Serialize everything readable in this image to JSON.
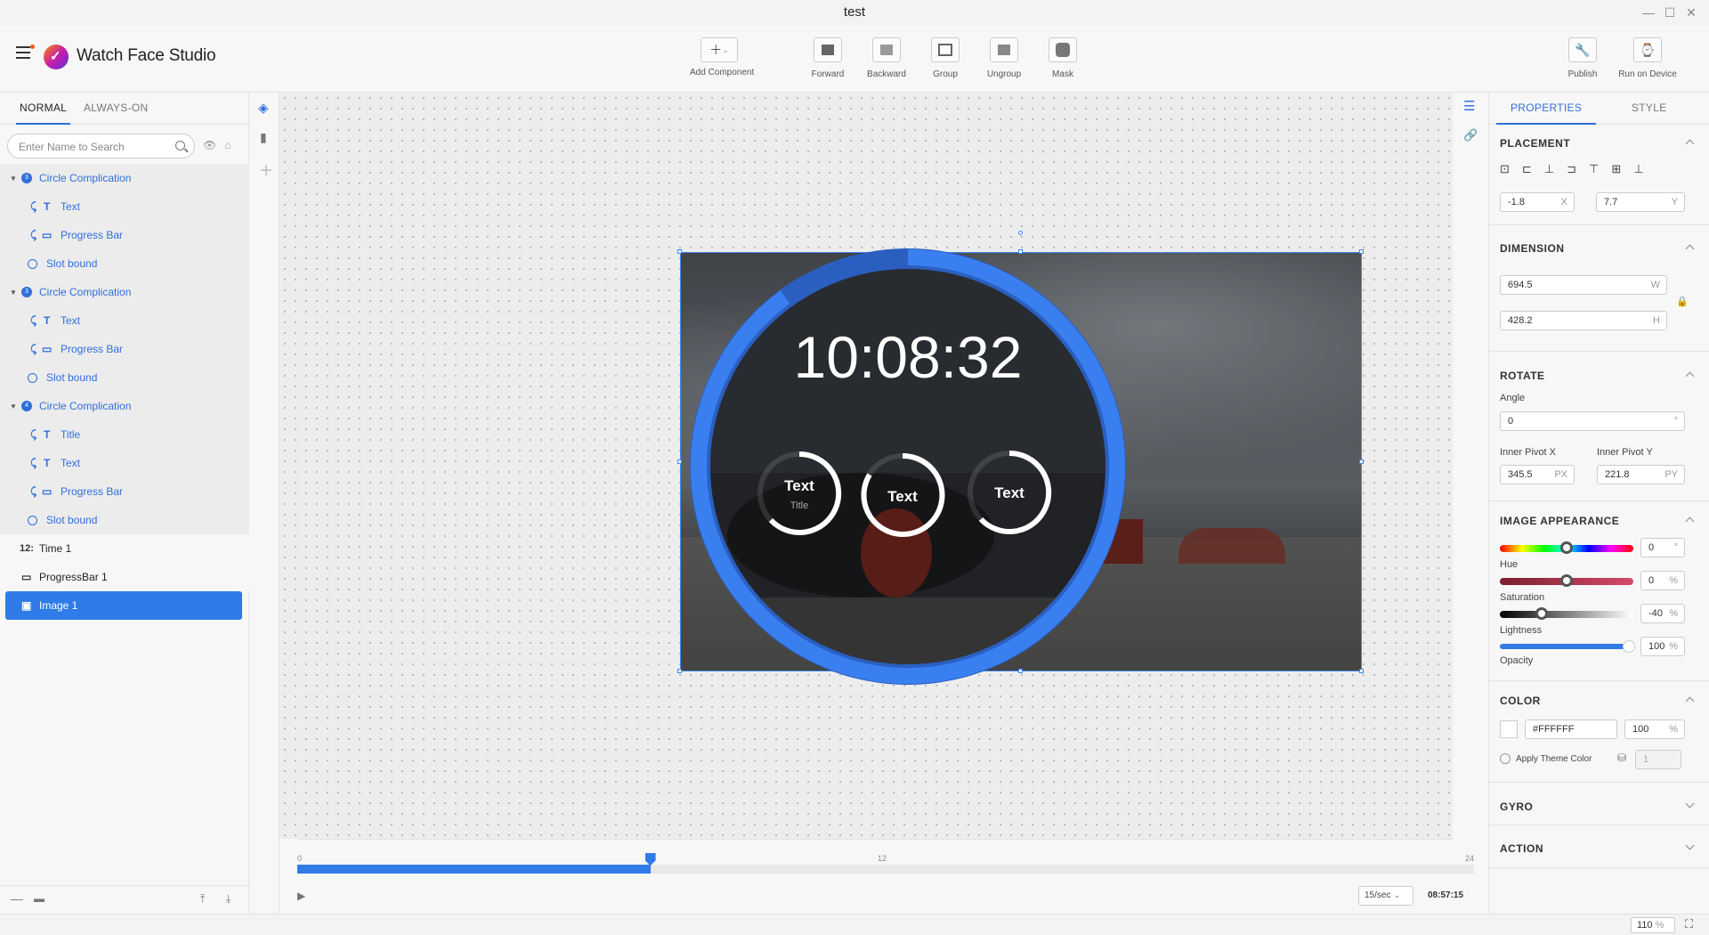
{
  "window": {
    "title": "test"
  },
  "app": {
    "name": "Watch Face Studio"
  },
  "toolbar": {
    "add_component": "Add Component",
    "forward": "Forward",
    "backward": "Backward",
    "group": "Group",
    "ungroup": "Ungroup",
    "mask": "Mask",
    "publish": "Publish",
    "run_on_device": "Run on Device"
  },
  "left": {
    "tabs": [
      "NORMAL",
      "ALWAYS-ON"
    ],
    "search_placeholder": "Enter Name to Search",
    "layers": [
      {
        "label": "Circle Complication",
        "badge": "3"
      },
      {
        "label": "Text",
        "glyph": "T"
      },
      {
        "label": "Progress Bar",
        "glyph": "▭"
      },
      {
        "label": "Slot bound"
      },
      {
        "label": "Circle Complication",
        "badge": "3"
      },
      {
        "label": "Text",
        "glyph": "T"
      },
      {
        "label": "Progress Bar",
        "glyph": "▭"
      },
      {
        "label": "Slot bound"
      },
      {
        "label": "Circle Complication",
        "badge": "4"
      },
      {
        "label": "Title",
        "glyph": "T"
      },
      {
        "label": "Text",
        "glyph": "T"
      },
      {
        "label": "Progress Bar",
        "glyph": "▭"
      },
      {
        "label": "Slot bound"
      },
      {
        "label": "Time 1",
        "glyph": "12:"
      },
      {
        "label": "ProgressBar 1"
      },
      {
        "label": "Image 1"
      }
    ]
  },
  "watch": {
    "time": "10:08:32",
    "comp1_text": "Text",
    "comp1_title": "Title",
    "comp2_text": "Text",
    "comp3_text": "Text",
    "progress_fraction": 0.9
  },
  "timeline": {
    "tick_start": "0",
    "tick_mid": "12",
    "tick_end": "24",
    "position_fraction": 0.3,
    "fps": "15/sec",
    "time": "08:57:15"
  },
  "right": {
    "tabs": [
      "PROPERTIES",
      "STYLE"
    ],
    "placement": {
      "title": "PLACEMENT",
      "x": "-1.8",
      "x_unit": "X",
      "y": "7.7",
      "y_unit": "Y"
    },
    "dimension": {
      "title": "DIMENSION",
      "w": "694.5",
      "w_unit": "W",
      "h": "428.2",
      "h_unit": "H"
    },
    "rotate": {
      "title": "ROTATE",
      "angle_label": "Angle",
      "angle": "0",
      "angle_unit": "°",
      "pivot_x_label": "Inner Pivot X",
      "pivot_y_label": "Inner Pivot Y",
      "pivot_x": "345.5",
      "pivot_x_unit": "PX",
      "pivot_y": "221.8",
      "pivot_y_unit": "PY"
    },
    "appearance": {
      "title": "IMAGE APPEARANCE",
      "hue_label": "Hue",
      "hue": "0",
      "hue_unit": "°",
      "sat_label": "Saturation",
      "sat": "0",
      "sat_unit": "%",
      "light_label": "Lightness",
      "light": "-40",
      "light_unit": "%",
      "opacity_label": "Opacity",
      "opacity": "100",
      "opacity_unit": "%"
    },
    "color": {
      "title": "COLOR",
      "hex": "#FFFFFF",
      "alpha": "100",
      "alpha_unit": "%",
      "theme_label": "Apply Theme Color",
      "theme_value": "1"
    },
    "gyro": {
      "title": "GYRO"
    },
    "action": {
      "title": "ACTION"
    }
  },
  "status": {
    "zoom": "110",
    "zoom_unit": "%"
  },
  "colors": {
    "accent": "#2f6fdc",
    "watch_ring": "#3a7ff0"
  }
}
